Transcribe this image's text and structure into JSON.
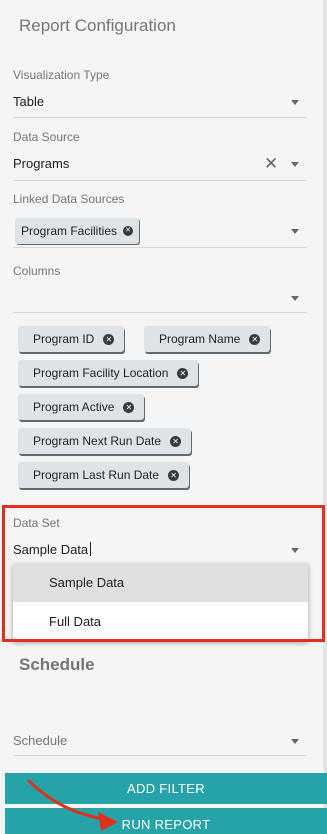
{
  "config": {
    "title": "Report Configuration",
    "visualization": {
      "label": "Visualization Type",
      "value": "Table"
    },
    "data_source": {
      "label": "Data Source",
      "value": "Programs"
    },
    "linked": {
      "label": "Linked Data Sources",
      "chip": "Program Facilities"
    },
    "columns": {
      "label": "Columns",
      "chips": [
        "Program ID",
        "Program Name",
        "Program Facility Location",
        "Program Active",
        "Program Next Run Date",
        "Program Last Run Date"
      ]
    },
    "data_set": {
      "label": "Data Set",
      "value": "Sample Data",
      "options": [
        "Sample Data",
        "Full Data"
      ]
    },
    "schedule": {
      "section_title": "Schedule",
      "label": "Schedule"
    },
    "buttons": {
      "add_filter": "ADD FILTER",
      "run_report": "RUN REPORT"
    }
  },
  "colors": {
    "accent": "#26a3a8",
    "highlight": "#e0301e",
    "chip": "#dfe3e5"
  },
  "icons": {
    "clear": "close-icon",
    "dropdown": "chevron-down-icon",
    "chip_remove": "remove-chip-icon",
    "annotation": "arrow-annotation"
  }
}
